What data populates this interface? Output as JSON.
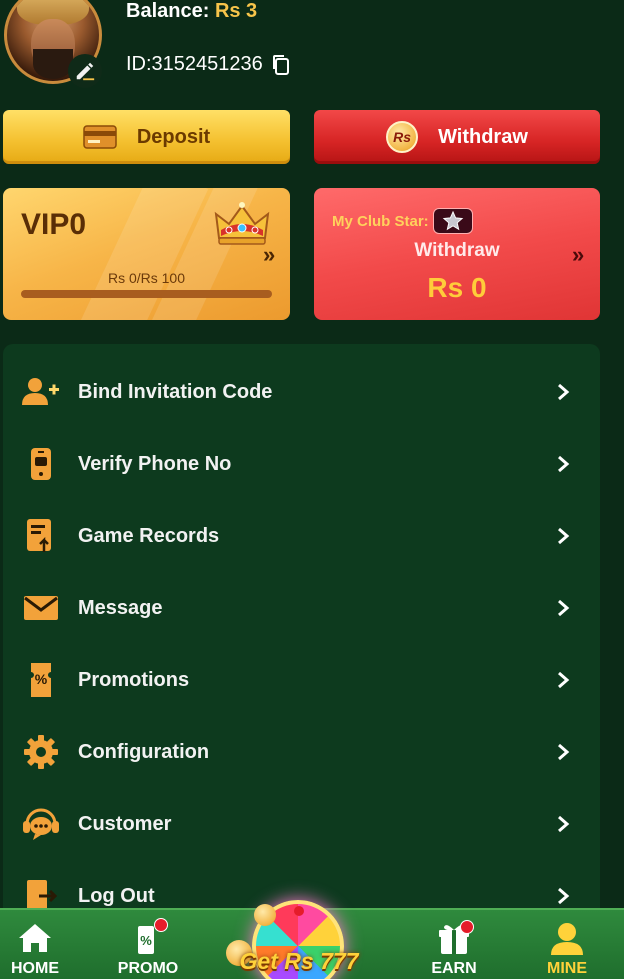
{
  "profile": {
    "balance_label": "Balance:",
    "balance_value": "Rs 3",
    "user_id": "ID:3152451236"
  },
  "actions": {
    "deposit_label": "Deposit",
    "withdraw_label": "Withdraw",
    "rs_coin_text": "Rs"
  },
  "vip": {
    "level": "VIP0",
    "progress_text": "Rs 0/Rs 100",
    "progress_fraction": 0
  },
  "club": {
    "label": "My Club Star:",
    "withdraw_label": "Withdraw",
    "amount": "Rs 0"
  },
  "menu": {
    "items": [
      {
        "label": "Bind Invitation Code",
        "icon": "add-user-icon"
      },
      {
        "label": "Verify Phone No",
        "icon": "phone-icon"
      },
      {
        "label": "Game Records",
        "icon": "records-icon"
      },
      {
        "label": "Message",
        "icon": "envelope-icon"
      },
      {
        "label": "Promotions",
        "icon": "promotion-ticket-icon"
      },
      {
        "label": "Configuration",
        "icon": "gear-icon"
      },
      {
        "label": "Customer",
        "icon": "customer-service-icon"
      },
      {
        "label": "Log Out",
        "icon": "logout-icon"
      }
    ]
  },
  "bottom_nav": {
    "home": "HOME",
    "promo": "PROMO",
    "center": "Get Rs 777",
    "earn": "EARN",
    "mine": "MINE",
    "active": "mine"
  },
  "colors": {
    "background": "#0b2a17",
    "accent_gold": "#f7c44a",
    "accent_red": "#d62424",
    "menu_bg": "#0d3a1e",
    "nav_bg": "#1f6e2d"
  }
}
